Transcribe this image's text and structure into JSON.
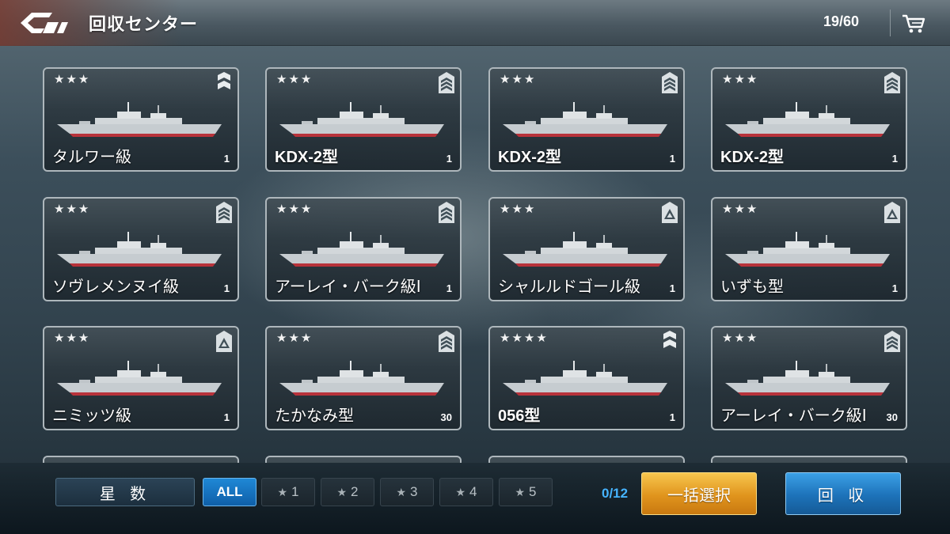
{
  "header": {
    "title": "回収センター",
    "capacity": "19/60"
  },
  "cards": [
    {
      "stars": "★★★",
      "name": "タルワー級",
      "count": "1",
      "rank": "dual-chevron"
    },
    {
      "stars": "★★★",
      "name": "KDX-2型",
      "count": "1",
      "rank": "triple-chevron"
    },
    {
      "stars": "★★★",
      "name": "KDX-2型",
      "count": "1",
      "rank": "triple-chevron"
    },
    {
      "stars": "★★★",
      "name": "KDX-2型",
      "count": "1",
      "rank": "triple-chevron"
    },
    {
      "stars": "★★★",
      "name": "ソヴレメンヌイ級",
      "count": "1",
      "rank": "triple-chevron"
    },
    {
      "stars": "★★★",
      "name": "アーレイ・バーク級I",
      "count": "1",
      "rank": "triple-chevron"
    },
    {
      "stars": "★★★",
      "name": "シャルルドゴール級",
      "count": "1",
      "rank": "triangle"
    },
    {
      "stars": "★★★",
      "name": "いずも型",
      "count": "1",
      "rank": "triangle"
    },
    {
      "stars": "★★★",
      "name": "ニミッツ級",
      "count": "1",
      "rank": "triangle"
    },
    {
      "stars": "★★★",
      "name": "たかなみ型",
      "count": "30",
      "rank": "triple-chevron"
    },
    {
      "stars": "★★★★",
      "name": "056型",
      "count": "1",
      "rank": "dual-chevron"
    },
    {
      "stars": "★★★",
      "name": "アーレイ・バーク級I",
      "count": "30",
      "rank": "triple-chevron"
    }
  ],
  "filters": {
    "label": "星 数",
    "options": [
      "ALL",
      "1",
      "2",
      "3",
      "4",
      "5"
    ],
    "active": "ALL"
  },
  "selection": {
    "count": "0/12",
    "select_all_label": "一括選択",
    "recover_label": "回 収"
  },
  "colors": {
    "accent_blue": "#1f88d6",
    "accent_gold": "#e0941d",
    "selection_text": "#46b4ff"
  }
}
